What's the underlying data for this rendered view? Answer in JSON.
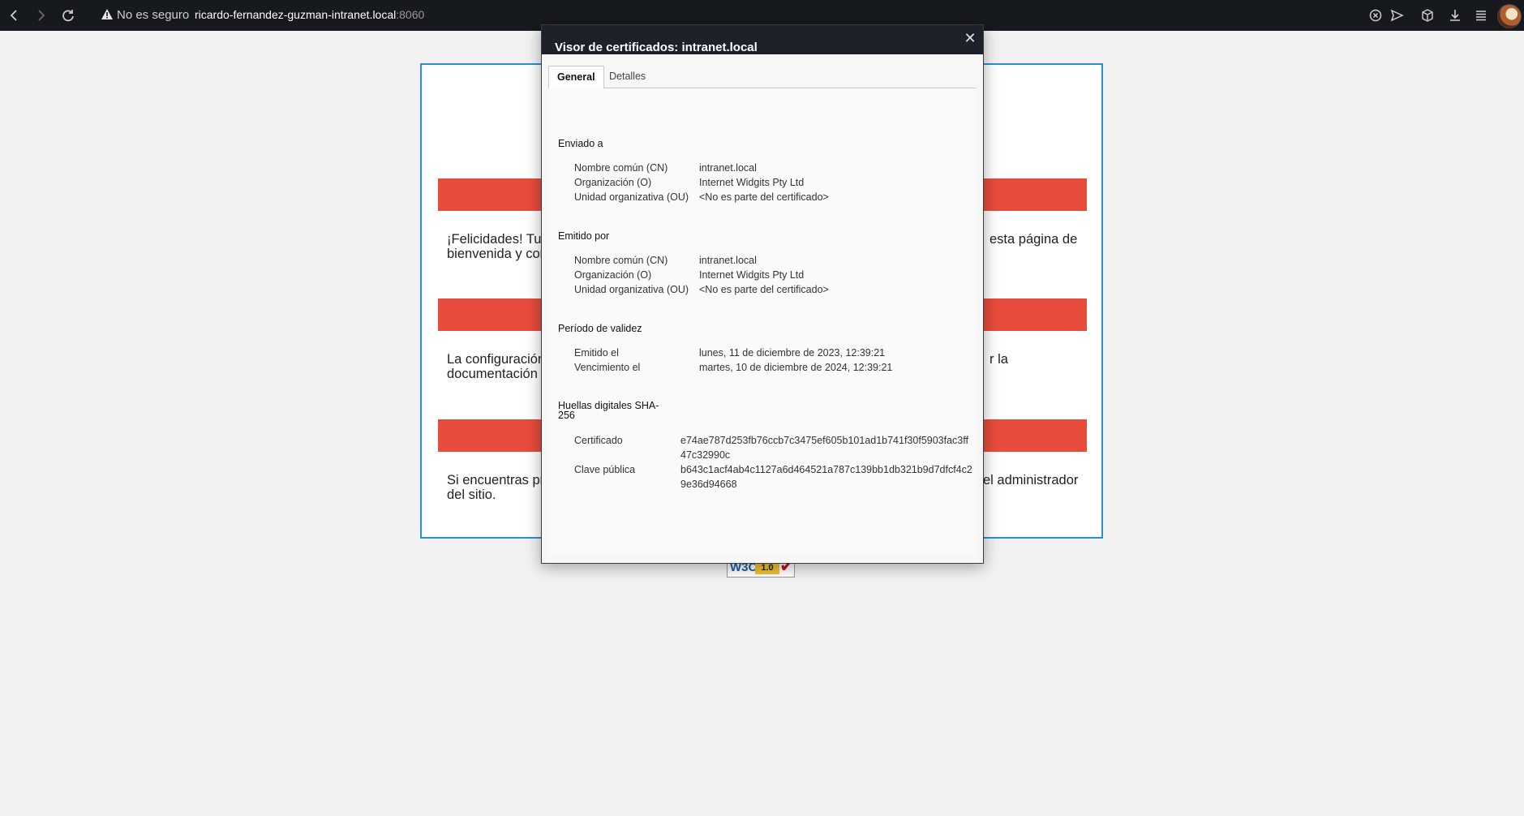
{
  "browser": {
    "security_label": "No es seguro",
    "url_host": "ricardo-fernandez-guzman-intranet.local",
    "url_port": ":8060",
    "toolbar_icons": [
      "back-icon",
      "forward-icon",
      "reload-icon",
      "shield-icon",
      "send-icon",
      "box-icon",
      "download-icon",
      "menu-icon"
    ]
  },
  "page": {
    "para1_left": "¡Felicidades! Tu",
    "para1_left2": "bienvenida y con",
    "para1_right": "esta página de",
    "para2_left": "La configuración",
    "para2_left2": "documentación e",
    "para2_right": "r la",
    "para3_left": "Si encuentras pr",
    "para3_left2": "del sitio.",
    "para3_right": "el administrador",
    "bar_color": "#e84c3d",
    "badge_text": "W3C",
    "badge_version": "1.0"
  },
  "dialog": {
    "title": "Visor de certificados: intranet.local",
    "close_glyph": "✕",
    "tabs": [
      {
        "label": "General",
        "active": true
      },
      {
        "label": "Detalles",
        "active": false
      }
    ],
    "issued_to": {
      "title": "Enviado a",
      "cn_label": "Nombre común (CN)",
      "cn_value": "intranet.local",
      "o_label": "Organización (O)",
      "o_value": "Internet Widgits Pty Ltd",
      "ou_label": "Unidad organizativa (OU)",
      "ou_value": "<No es parte del certificado>"
    },
    "issued_by": {
      "title": "Emitido por",
      "cn_label": "Nombre común (CN)",
      "cn_value": "intranet.local",
      "o_label": "Organización (O)",
      "o_value": "Internet Widgits Pty Ltd",
      "ou_label": "Unidad organizativa (OU)",
      "ou_value": "<No es parte del certificado>"
    },
    "validity": {
      "title": "Período de validez",
      "issued_label": "Emitido el",
      "issued_value": "lunes, 11 de diciembre de 2023, 12:39:21",
      "expires_label": "Vencimiento el",
      "expires_value": "martes, 10 de diciembre de 2024, 12:39:21"
    },
    "fingerprints": {
      "title": "Huellas digitales SHA-256",
      "cert_label": "Certificado",
      "cert_value": "e74ae787d253fb76ccb7c3475ef605b101ad1b741f30f5903fac3ff47c32990c",
      "key_label": "Clave pública",
      "key_value": "b643c1acf4ab4c1127a6d464521a787c139bb1db321b9d7dfcf4c29e36d94668"
    }
  }
}
